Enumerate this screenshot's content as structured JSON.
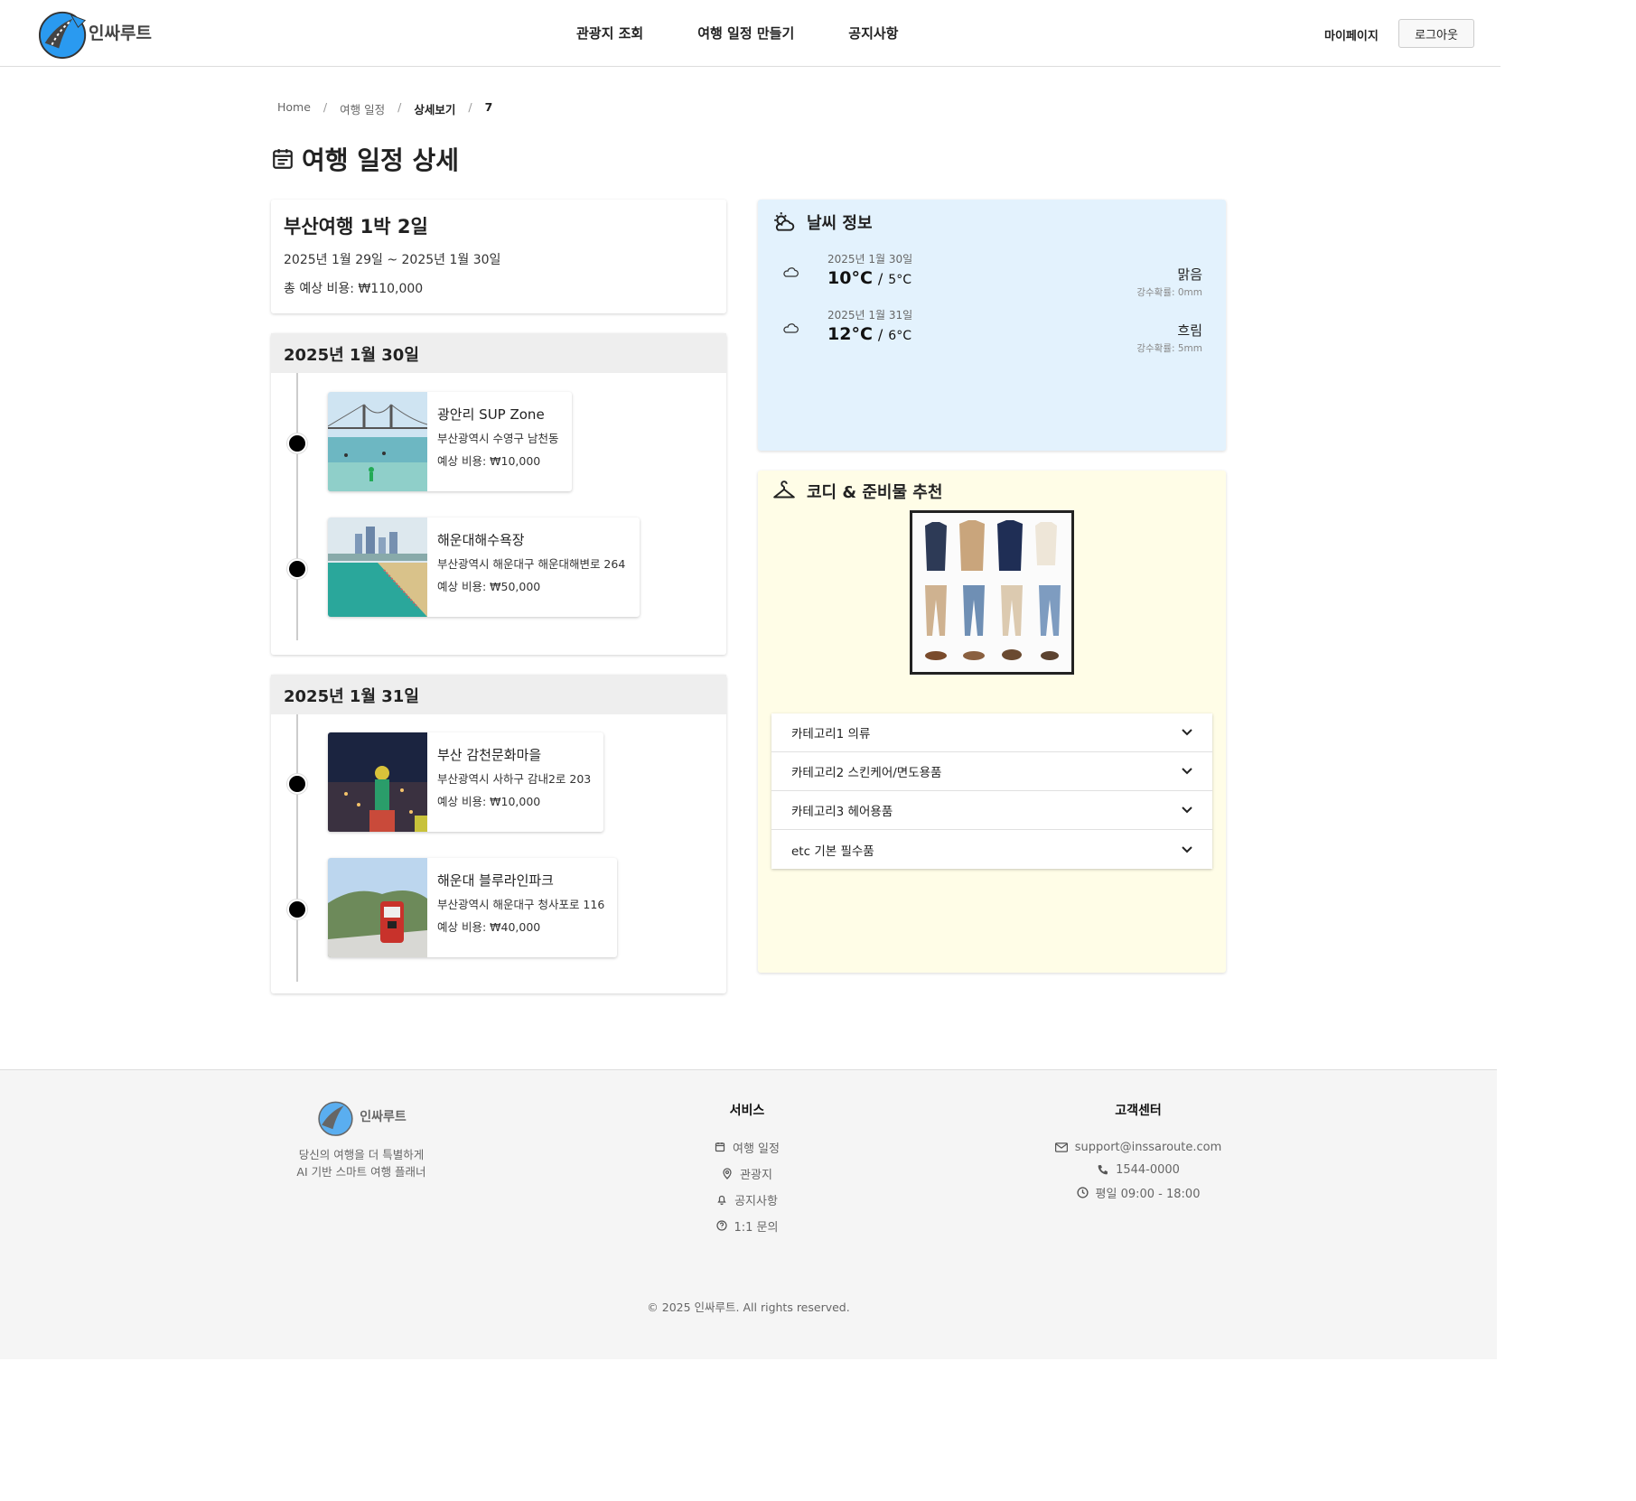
{
  "header": {
    "logo_text": "인싸루트",
    "nav": [
      "관광지 조회",
      "여행 일정 만들기",
      "공지사항"
    ],
    "mypage": "마이페이지",
    "logout": "로그아웃"
  },
  "breadcrumb": [
    "Home",
    "여행 일정",
    "상세보기",
    "7"
  ],
  "page_title": "여행 일정 상세",
  "summary": {
    "title": "부산여행 1박 2일",
    "dates": "2025년 1월 29일 ~ 2025년 1월 30일",
    "cost": "총 예상 비용: ₩110,000"
  },
  "days": [
    {
      "date": "2025년 1월 30일",
      "places": [
        {
          "name": "광안리 SUP Zone",
          "address": "부산광역시 수영구 남천동",
          "cost": "예상 비용: ₩10,000"
        },
        {
          "name": "해운대해수욕장",
          "address": "부산광역시 해운대구 해운대해변로 264",
          "cost": "예상 비용: ₩50,000"
        }
      ]
    },
    {
      "date": "2025년 1월 31일",
      "places": [
        {
          "name": "부산 감천문화마을",
          "address": "부산광역시 사하구 감내2로 203",
          "cost": "예상 비용: ₩10,000"
        },
        {
          "name": "해운대 블루라인파크",
          "address": "부산광역시 해운대구 청사포로 116",
          "cost": "예상 비용: ₩40,000"
        }
      ]
    }
  ],
  "weather": {
    "title": "날씨 정보",
    "days": [
      {
        "date": "2025년 1월 30일",
        "high": "10°C",
        "low": "5°C",
        "condition": "맑음",
        "rain": "강수확률: 0mm"
      },
      {
        "date": "2025년 1월 31일",
        "high": "12°C",
        "low": "6°C",
        "condition": "흐림",
        "rain": "강수확률: 5mm"
      }
    ]
  },
  "outfit": {
    "title": "코디 & 준비물 추천",
    "categories": [
      "카테고리1 의류",
      "카테고리2 스킨케어/면도용품",
      "카테고리3 헤어용품",
      "etc 기본 필수품"
    ]
  },
  "footer": {
    "logo_text": "인싸루트",
    "tagline_1": "당신의 여행을 더 특별하게",
    "tagline_2": "AI 기반 스마트 여행 플래너",
    "service_title": "서비스",
    "services": [
      "여행 일정",
      "관광지",
      "공지사항",
      "1:1 문의"
    ],
    "cs_title": "고객센터",
    "email": "support@inssaroute.com",
    "phone": "1544-0000",
    "hours": "평일 09:00 - 18:00",
    "copyright": "© 2025 인싸루트. All rights reserved."
  },
  "colors": {
    "weather_bg": "#e3f2fd",
    "outfit_bg": "#fffde7",
    "day_header_bg": "#eeeeee",
    "logo_blue": "#2196f3"
  }
}
